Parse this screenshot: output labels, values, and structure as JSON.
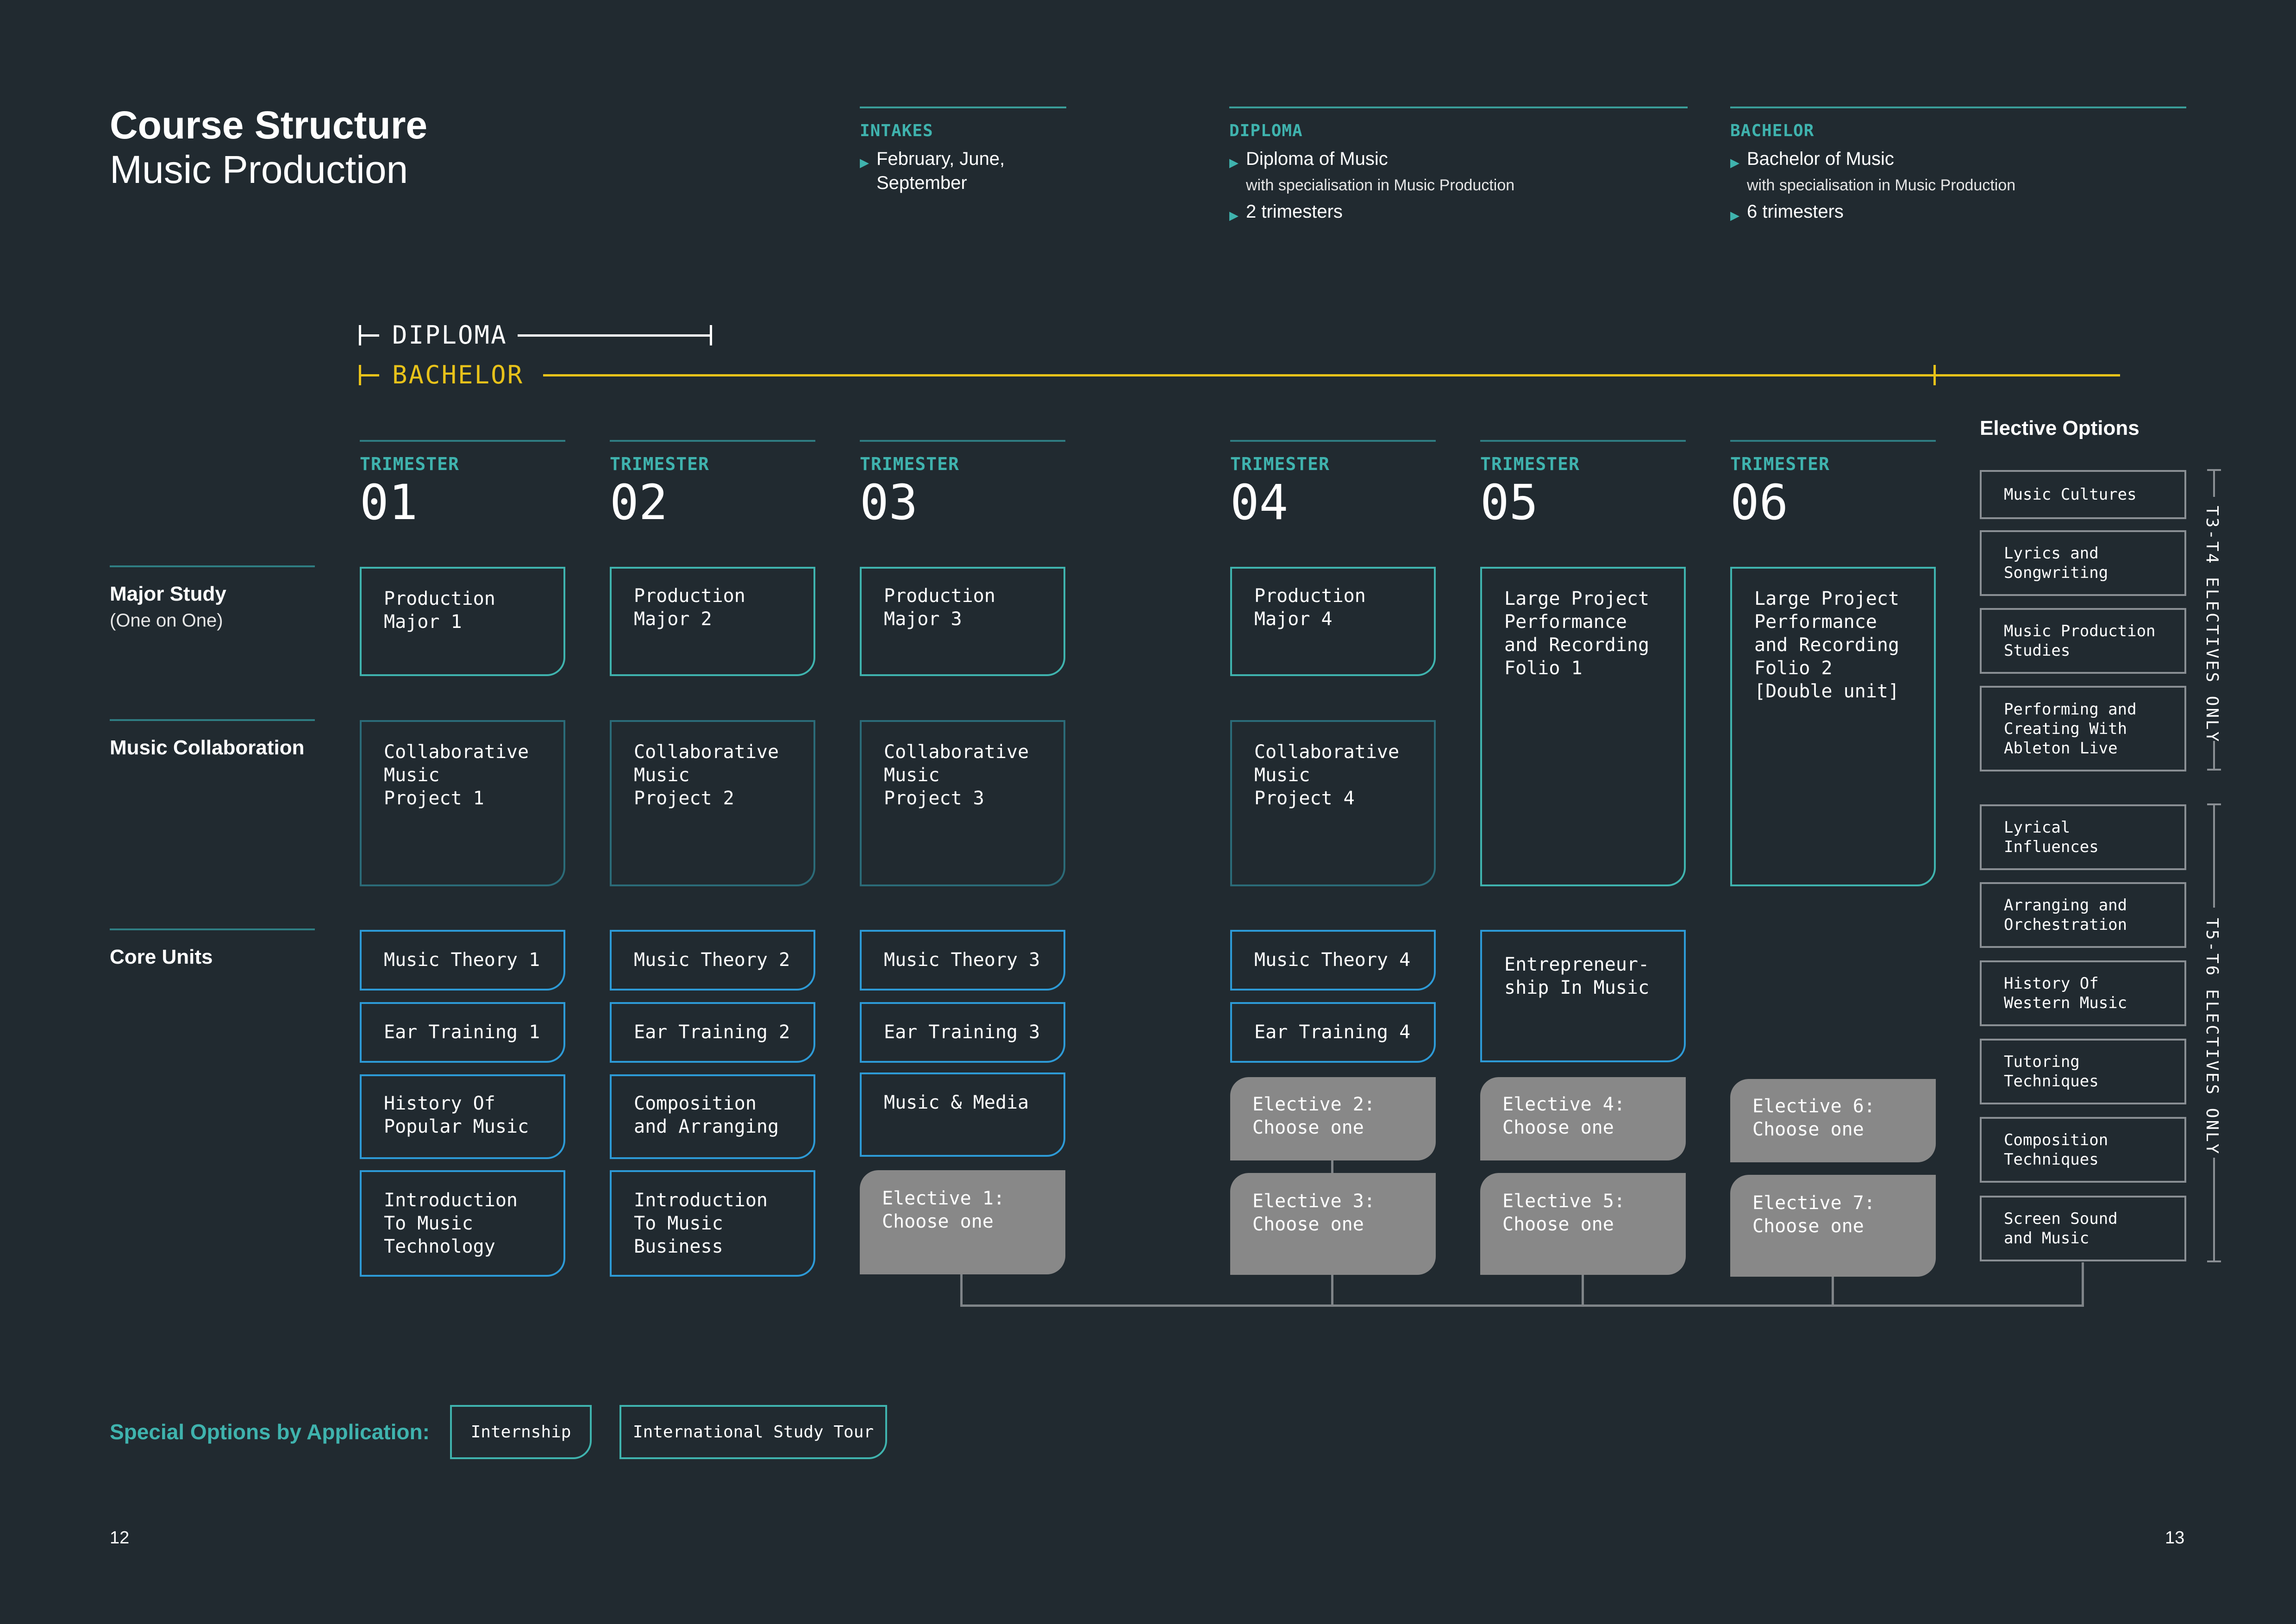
{
  "header": {
    "title": "Course Structure",
    "subtitle": "Music Production"
  },
  "info": {
    "intakes": {
      "heading": "INTAKES",
      "line": "February, June,\nSeptember"
    },
    "diploma": {
      "heading": "DIPLOMA",
      "name": "Diploma of Music",
      "spec": "with specialisation in Music Production",
      "duration": "2 trimesters"
    },
    "bachelor": {
      "heading": "BACHELOR",
      "name": "Bachelor of Music",
      "spec": "with specialisation in Music Production",
      "duration": "6 trimesters"
    }
  },
  "durations": {
    "diploma": "DIPLOMA",
    "bachelor": "BACHELOR"
  },
  "colors": {
    "teal": "#3fb3ae",
    "gold": "#e8c21a",
    "elective": "#888888",
    "background": "#212a30"
  },
  "trimester_label": "TRIMESTER",
  "trimesters": [
    "01",
    "02",
    "03",
    "04",
    "05",
    "06"
  ],
  "rows": {
    "major": {
      "label": "Major Study",
      "sub": "(One on One)"
    },
    "collab": {
      "label": "Music Collaboration"
    },
    "core": {
      "label": "Core Units"
    }
  },
  "boxes": {
    "major": [
      "Production\nMajor 1",
      "Production\nMajor 2",
      "Production\nMajor 3",
      "Production\nMajor 4",
      "Large Project\nPerformance\nand Recording\nFolio 1",
      "Large Project\nPerformance\nand Recording\nFolio 2\n[Double unit]"
    ],
    "collab": [
      "Collaborative\nMusic\nProject 1",
      "Collaborative\nMusic\nProject 2",
      "Collaborative\nMusic\nProject 3",
      "Collaborative\nMusic\nProject 4"
    ],
    "core": {
      "t1": [
        "Music Theory 1",
        "Ear Training 1",
        "History Of\nPopular Music",
        "Introduction\nTo Music\nTechnology"
      ],
      "t2": [
        "Music Theory 2",
        "Ear Training 2",
        "Composition\nand Arranging",
        "Introduction\nTo Music\nBusiness"
      ],
      "t3": [
        "Music Theory 3",
        "Ear Training 3",
        "Music & Media"
      ],
      "t4": [
        "Music Theory 4",
        "Ear Training 4"
      ],
      "t5": [
        "Entrepreneur-\nship In Music"
      ]
    },
    "electives": [
      "Elective 1:\nChoose one",
      "Elective 2:\nChoose one",
      "Elective 3:\nChoose one",
      "Elective 4:\nChoose one",
      "Elective 5:\nChoose one",
      "Elective 6:\nChoose one",
      "Elective 7:\nChoose one"
    ]
  },
  "elective_options": {
    "title": "Elective Options",
    "group1_label": "T3-T4 ELECTIVES ONLY",
    "group2_label": "T5-T6 ELECTIVES ONLY",
    "items": [
      "Music Cultures",
      "Lyrics and\nSongwriting",
      "Music Production\nStudies",
      "Performing and\nCreating With\nAbleton Live",
      "Lyrical\nInfluences",
      "Arranging and\nOrchestration",
      "History Of\nWestern Music",
      "Tutoring\nTechniques",
      "Composition\nTechniques",
      "Screen Sound\nand Music"
    ]
  },
  "special": {
    "label": "Special Options by Application:",
    "options": [
      "Internship",
      "International Study Tour"
    ]
  },
  "pages": {
    "left": "12",
    "right": "13"
  }
}
